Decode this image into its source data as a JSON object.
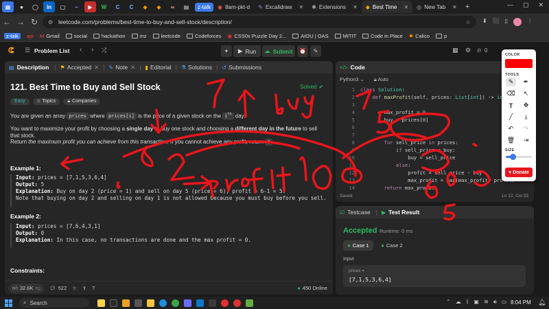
{
  "browser": {
    "tabs": [
      {
        "label": "z-talk",
        "active": false
      },
      {
        "label": "8am-pkt-d",
        "active": false
      },
      {
        "label": "Excalidraw",
        "active": false
      },
      {
        "label": "Extensions",
        "active": false
      },
      {
        "label": "Best Time",
        "active": true
      },
      {
        "label": "New Tab",
        "active": false
      }
    ],
    "url": "leetcode.com/problems/best-time-to-buy-and-sell-stock/description/",
    "bookmarks": [
      "z-talk",
      "api",
      "Gmail",
      "social",
      "hackathon",
      "mz",
      "leetcode",
      "Codeforces",
      "CSS0x Puzzle Day 2...",
      "AIOU | OAS",
      "MITIT",
      "Code in Place",
      "Calico",
      "p"
    ]
  },
  "nav": {
    "problem_list": "Problem List",
    "run": "Run",
    "submit": "Submit",
    "streak": "0"
  },
  "description": {
    "tabs": [
      "Description",
      "Accepted",
      "Note",
      "Editorial",
      "Solutions",
      "Submissions"
    ],
    "title": "121. Best Time to Buy and Sell Stock",
    "status": "Solved",
    "tags": [
      "Easy",
      "Topics",
      "Companies"
    ],
    "p1_a": "You are given an array ",
    "p1_code1": "prices",
    "p1_b": " where ",
    "p1_code2": "prices[i]",
    "p1_c": " is the price of a given stock on the ",
    "p1_d": "i",
    "p1_sup": "th",
    "p1_e": " day.",
    "p2_a": "You want to maximize your profit by choosing a ",
    "p2_b": "single day",
    "p2_c": " to buy one stock and choosing a ",
    "p2_d": "different day in the future",
    "p2_e": " to sell that stock.",
    "p3_a": "Return ",
    "p3_b": "the maximum profit you can achieve from this transaction",
    "p3_c": ". If you cannot achieve any profit, return ",
    "p3_code": "0",
    "p3_d": ".",
    "example1": {
      "title": "Example 1:",
      "input_label": "Input:",
      "input": " prices = [7,1,5,3,6,4]",
      "output_label": "Output:",
      "output": " 5",
      "expl_label": "Explanation:",
      "expl": " Buy on day 2 (price = 1) and sell on day 5 (price = 6), profit = 6-1 = 5.",
      "note": "Note that buying on day 2 and selling on day 1 is not allowed because you must buy before you sell."
    },
    "example2": {
      "title": "Example 2:",
      "input_label": "Input:",
      "input": " prices = [7,6,4,3,1]",
      "output_label": "Output:",
      "output": " 0",
      "expl_label": "Explanation:",
      "expl": " In this case, no transactions are done and the max profit = 0."
    },
    "constraints": "Constraints:",
    "likes": "32.6K",
    "comments": "522",
    "online": "450 Online"
  },
  "code": {
    "header": "Code",
    "language": "Python3",
    "mode": "Auto",
    "status_saved": "Saved",
    "cursor": "Ln 12, Col 33"
  },
  "result": {
    "tabs": [
      "Testcase",
      "Test Result"
    ],
    "verdict": "Accepted",
    "runtime": "Runtime: 0 ms",
    "cases": [
      "Case 1",
      "Case 2"
    ],
    "input_label": "Input",
    "var_name": "prices =",
    "var_value": "[7,1,5,3,6,4]"
  },
  "tool": {
    "color_label": "COLOR",
    "tools_label": "TOOLS",
    "size_label": "SIZE",
    "donate": "Donate",
    "selected_color": "#ff0000"
  },
  "taskbar": {
    "search": "Search",
    "time": "8:04 PM"
  }
}
